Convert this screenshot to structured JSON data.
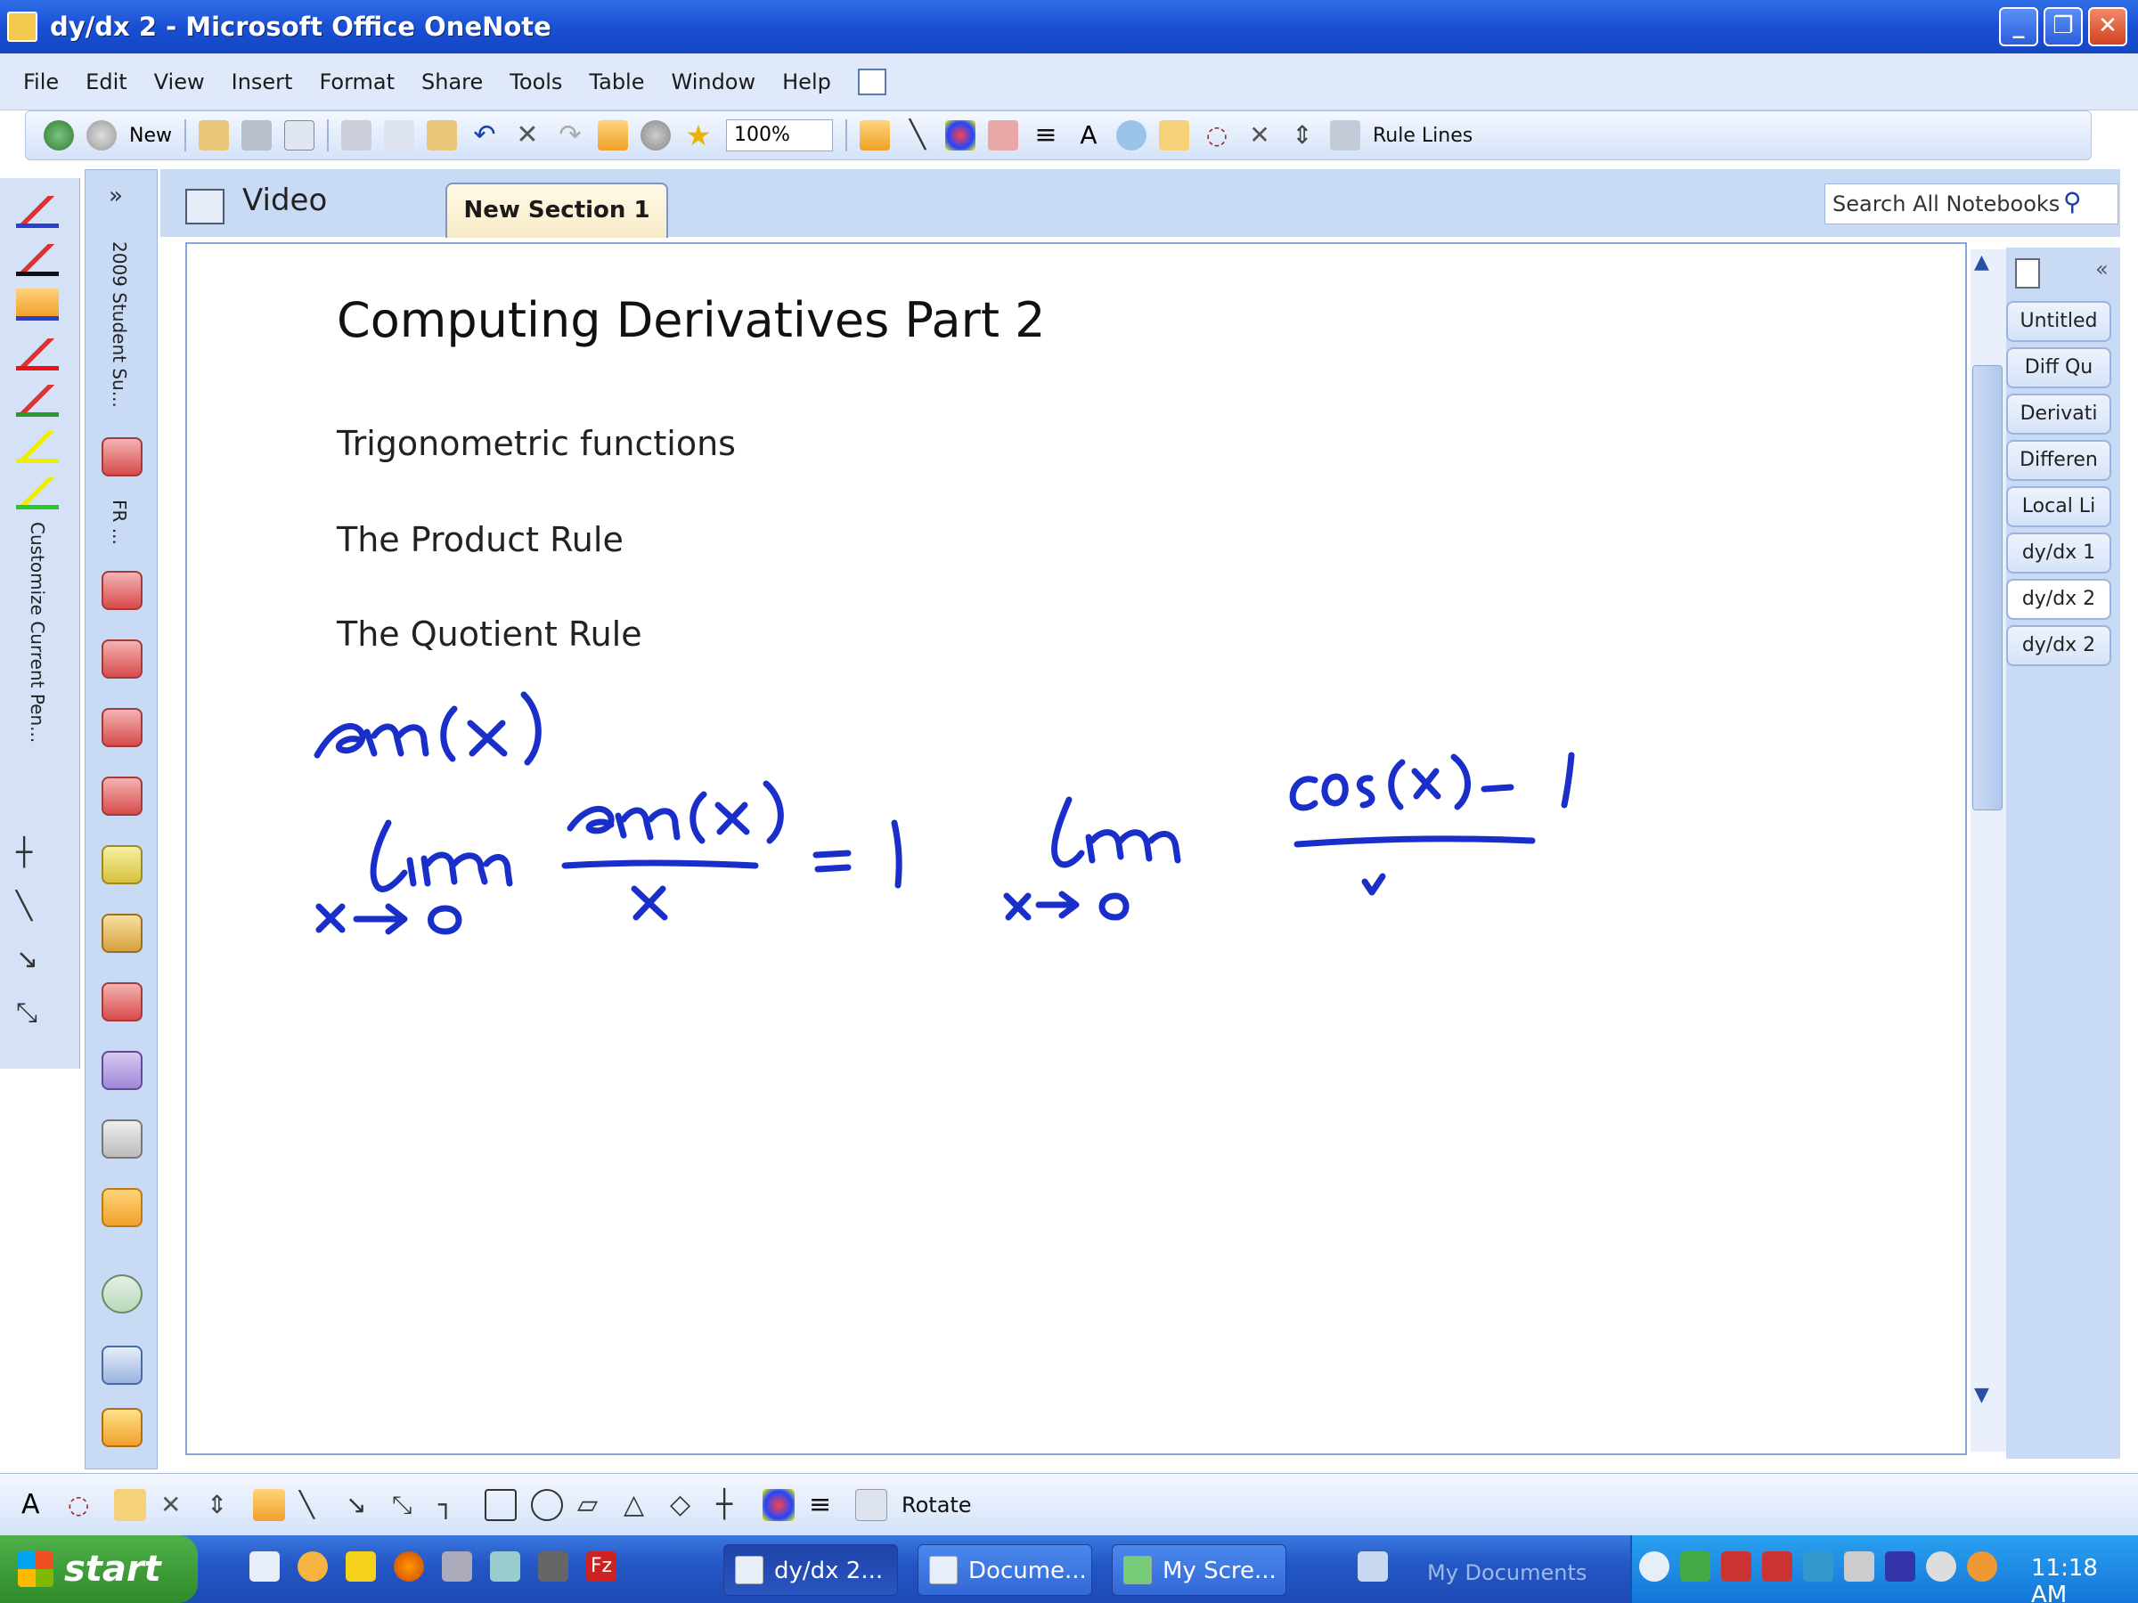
{
  "window": {
    "title": "dy/dx 2 - Microsoft Office OneNote"
  },
  "menubar": {
    "items": [
      "File",
      "Edit",
      "View",
      "Insert",
      "Format",
      "Share",
      "Tools",
      "Table",
      "Window",
      "Help"
    ]
  },
  "toolbar": {
    "new_label": "New",
    "zoom": "100%",
    "rule_lines": "Rule Lines"
  },
  "tabs": {
    "notebook": "Video",
    "section": "New Section 1"
  },
  "search": {
    "placeholder": "Search All Notebooks"
  },
  "sidebar": {
    "pen_panel_label": "Customize Current Pen...",
    "notebook_labels": [
      "2009 Student Su...",
      "FR ..."
    ]
  },
  "page": {
    "title": "Computing Derivatives Part 2",
    "lines": [
      "Trigonometric functions",
      "The Product Rule",
      "The Quotient Rule"
    ]
  },
  "page_tabs": [
    "Untitled",
    "Diff Qu",
    "Derivati",
    "Differen",
    "Local Li",
    "dy/dx 1",
    "dy/dx 2",
    "dy/dx 2"
  ],
  "drawbar": {
    "rotate_label": "Rotate"
  },
  "taskbar": {
    "start": "start",
    "tasks": [
      "dy/dx 2...",
      "Docume...",
      "My Scre..."
    ],
    "my_documents": "My Documents",
    "clock": "11:18 AM"
  },
  "colors": {
    "ink": "#1a2fc9",
    "titlebar": "#1a4fd4",
    "taskbar": "#2458c6",
    "start": "#3a9a35"
  }
}
